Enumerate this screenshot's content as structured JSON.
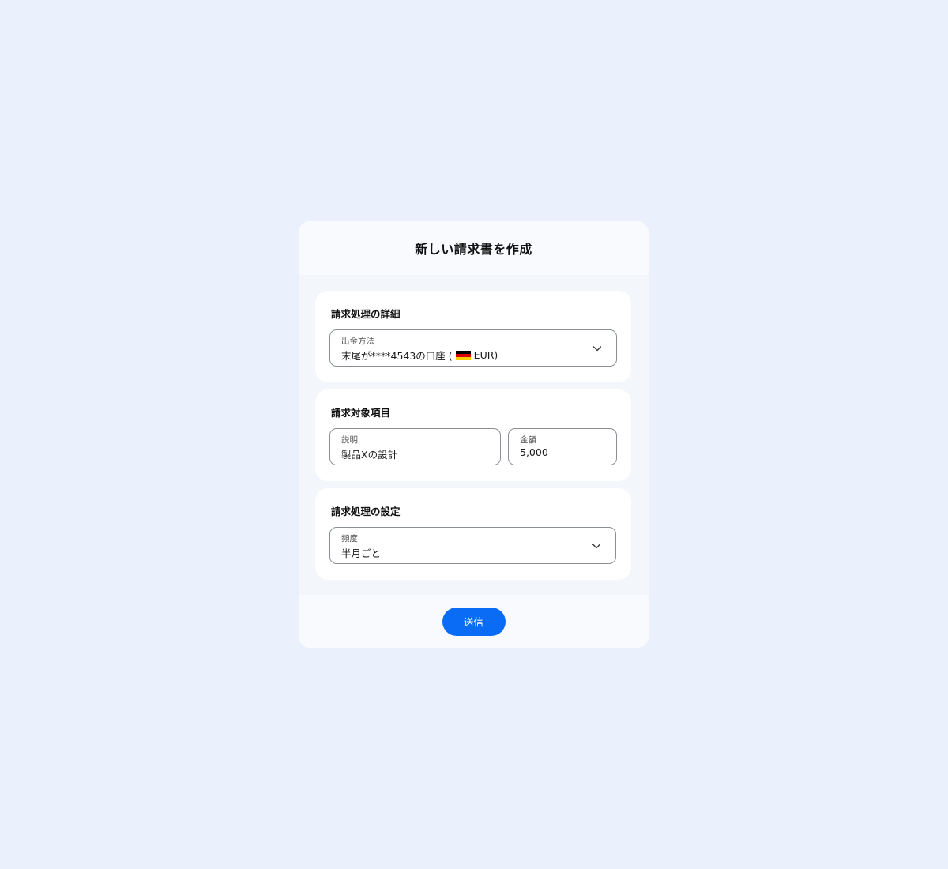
{
  "modal": {
    "title": "新しい請求書を作成"
  },
  "billing_details": {
    "title": "請求処理の詳細",
    "payout": {
      "label": "出金方法",
      "value_prefix": "末尾が****4543の口座 (",
      "currency": "EUR)",
      "flag_icon": "germany-flag-icon",
      "flag_colors": [
        "#000000",
        "#dd0000",
        "#ffce00"
      ]
    }
  },
  "billing_items": {
    "title": "請求対象項目",
    "description": {
      "label": "説明",
      "value": "製品Xの設計"
    },
    "amount": {
      "label": "金額",
      "value": "5,000"
    }
  },
  "billing_settings": {
    "title": "請求処理の設定",
    "frequency": {
      "label": "頻度",
      "value": "半月ごと"
    }
  },
  "footer": {
    "submit_label": "送信",
    "accent_color": "#0a6cf5"
  }
}
